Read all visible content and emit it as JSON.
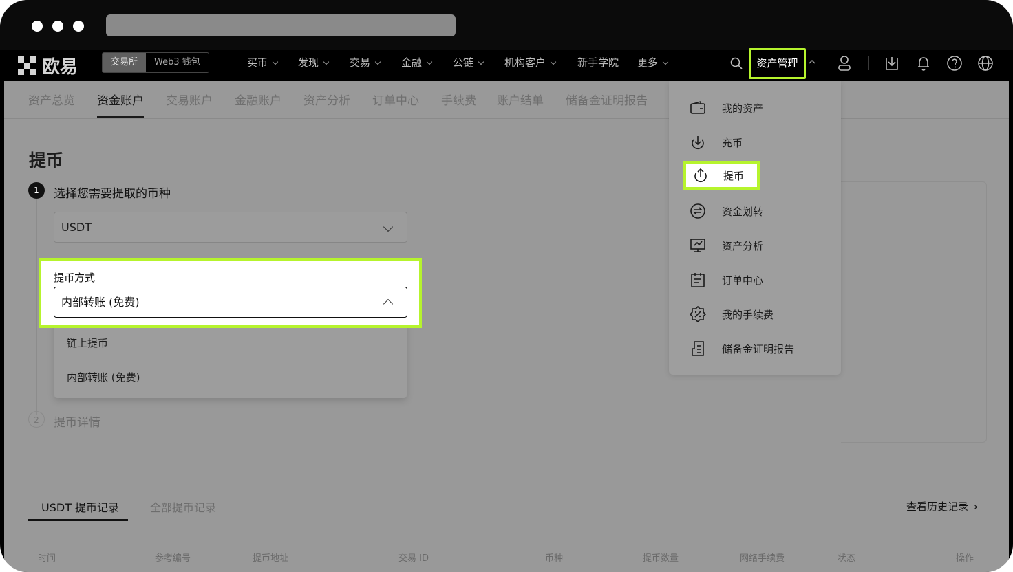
{
  "nav": {
    "brand": "欧易",
    "segment": [
      "交易所",
      "Web3 钱包"
    ],
    "items": [
      "买币",
      "发现",
      "交易",
      "金融",
      "公链",
      "机构客户",
      "新手学院",
      "更多"
    ],
    "asset_menu": "资产管理"
  },
  "subnav": [
    "资产总览",
    "资金账户",
    "交易账户",
    "金融账户",
    "资产分析",
    "订单中心",
    "手续费",
    "账户结单",
    "储备金证明报告"
  ],
  "page": {
    "title": "提币",
    "step1_num": "1",
    "step1_label": "选择您需要提取的币种",
    "coin_value": "USDT",
    "method_label": "提币方式",
    "method_value": "内部转账 (免费)",
    "method_options": [
      "链上提币",
      "内部转账 (免费)"
    ],
    "step2_num": "2",
    "step2_label": "提币详情"
  },
  "records": {
    "tab_active": "USDT 提币记录",
    "tab_other": "全部提币记录",
    "history_link": "查看历史记录",
    "columns": [
      "时间",
      "参考编号",
      "提币地址",
      "交易 ID",
      "币种",
      "提币数量",
      "网络手续费",
      "状态",
      "操作"
    ]
  },
  "asset_panel": {
    "items": [
      {
        "label": "我的资产",
        "icon": "wallet-icon"
      },
      {
        "label": "充币",
        "icon": "deposit-icon"
      },
      {
        "label": "提币",
        "icon": "withdraw-icon"
      },
      {
        "label": "资金划转",
        "icon": "transfer-icon"
      },
      {
        "label": "资产分析",
        "icon": "analysis-icon"
      },
      {
        "label": "订单中心",
        "icon": "order-icon"
      },
      {
        "label": "我的手续费",
        "icon": "fee-icon"
      },
      {
        "label": "储备金证明报告",
        "icon": "report-icon"
      }
    ]
  },
  "colors": {
    "highlight": "#b6f42d"
  }
}
